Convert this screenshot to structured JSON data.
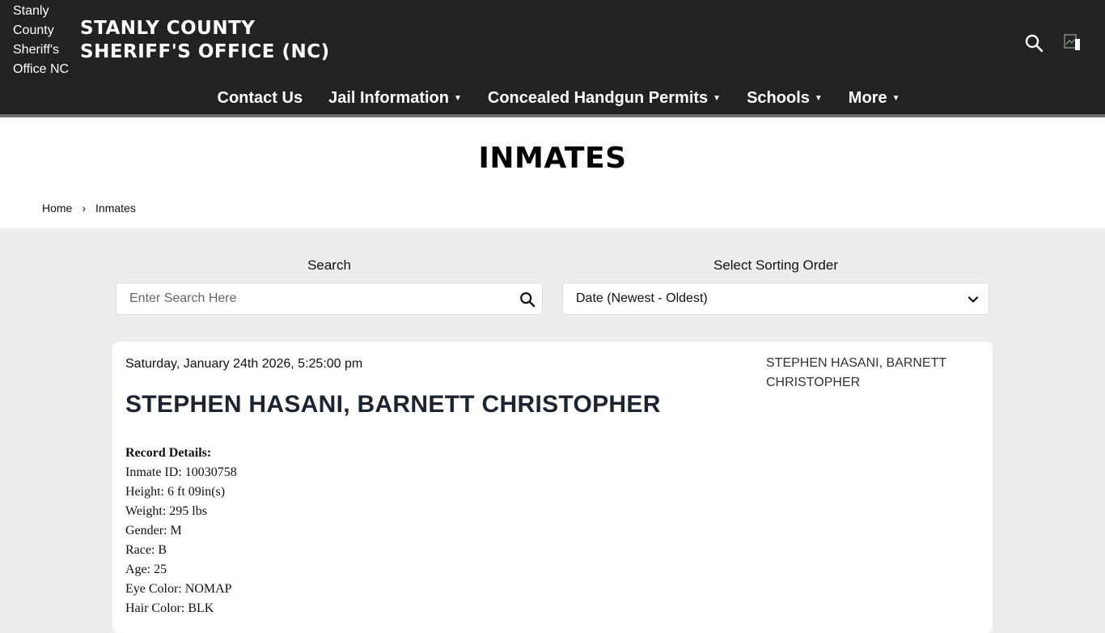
{
  "header": {
    "logo_alt": "Stanly County Sheriff's Office NC",
    "site_title_line1": "STANLY COUNTY",
    "site_title_line2": "SHERIFF'S OFFICE (NC)"
  },
  "nav": {
    "items": [
      {
        "label": "Contact Us",
        "has_dropdown": false
      },
      {
        "label": "Jail Information",
        "has_dropdown": true
      },
      {
        "label": "Concealed Handgun Permits",
        "has_dropdown": true
      },
      {
        "label": "Schools",
        "has_dropdown": true
      },
      {
        "label": "More",
        "has_dropdown": true
      }
    ]
  },
  "page": {
    "title": "INMATES",
    "breadcrumb": {
      "home": "Home",
      "separator": "›",
      "current": "Inmates"
    }
  },
  "filters": {
    "search_label": "Search",
    "search_placeholder": "Enter Search Here",
    "search_value": "",
    "sort_label": "Select Sorting Order",
    "sort_value": "Date (Newest - Oldest)"
  },
  "record": {
    "date": "Saturday, January 24th 2026, 5:25:00 pm",
    "name": "STEPHEN HASANI, BARNETT CHRISTOPHER",
    "photo_alt": "STEPHEN HASANI, BARNETT CHRISTOPHER",
    "details_heading": "Record Details:",
    "details": [
      "Inmate ID: 10030758",
      "Height: 6 ft 09in(s)",
      "Weight: 295 lbs",
      "Gender: M",
      "Race: B",
      "Age: 25",
      "Eye Color: NOMAP",
      "Hair Color: BLK"
    ]
  },
  "colors": {
    "header_bg": "#222222",
    "header_border": "#6b6b6b",
    "body_bg": "#ededed",
    "card_bg": "#ffffff"
  },
  "icons": {
    "header_search": "search-icon",
    "header_flag": "broken-image-icon",
    "search_field": "search-icon",
    "sort_dropdown": "chevron-down-icon",
    "nav_caret": "caret-down-icon"
  }
}
